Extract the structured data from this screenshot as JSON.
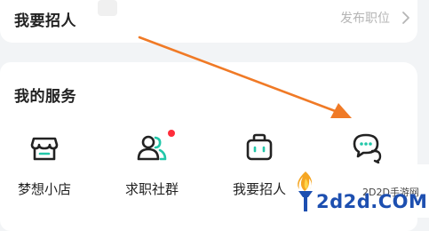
{
  "hire": {
    "title": "我要招人",
    "post_link": "发布职位",
    "chevron_icon": "chevron-right-icon"
  },
  "services": {
    "title": "我的服务",
    "items": [
      {
        "label": "梦想小店",
        "icon": "storefront-icon",
        "badge": false
      },
      {
        "label": "求职社群",
        "icon": "people-group-icon",
        "badge": true
      },
      {
        "label": "我要招人",
        "icon": "briefcase-icon",
        "badge": false
      },
      {
        "label": "",
        "icon": "chat-bubbles-icon",
        "badge": false
      }
    ]
  },
  "annotation": {
    "arrow_color": "#f07a26",
    "arrow_icon": "pointer-arrow"
  },
  "watermark": {
    "brand": "2d2d.COM",
    "tagline": "2D2D手游网",
    "logo_icon": "torch-flame-logo"
  },
  "colors": {
    "background": "#f2f4f6",
    "card": "#ffffff",
    "icon_stroke": "#222222",
    "icon_accent": "#22c7a9",
    "badge_red": "#ff2d3b",
    "muted_text": "#b5b5b5",
    "watermark_blue": "#1d4fb0"
  }
}
